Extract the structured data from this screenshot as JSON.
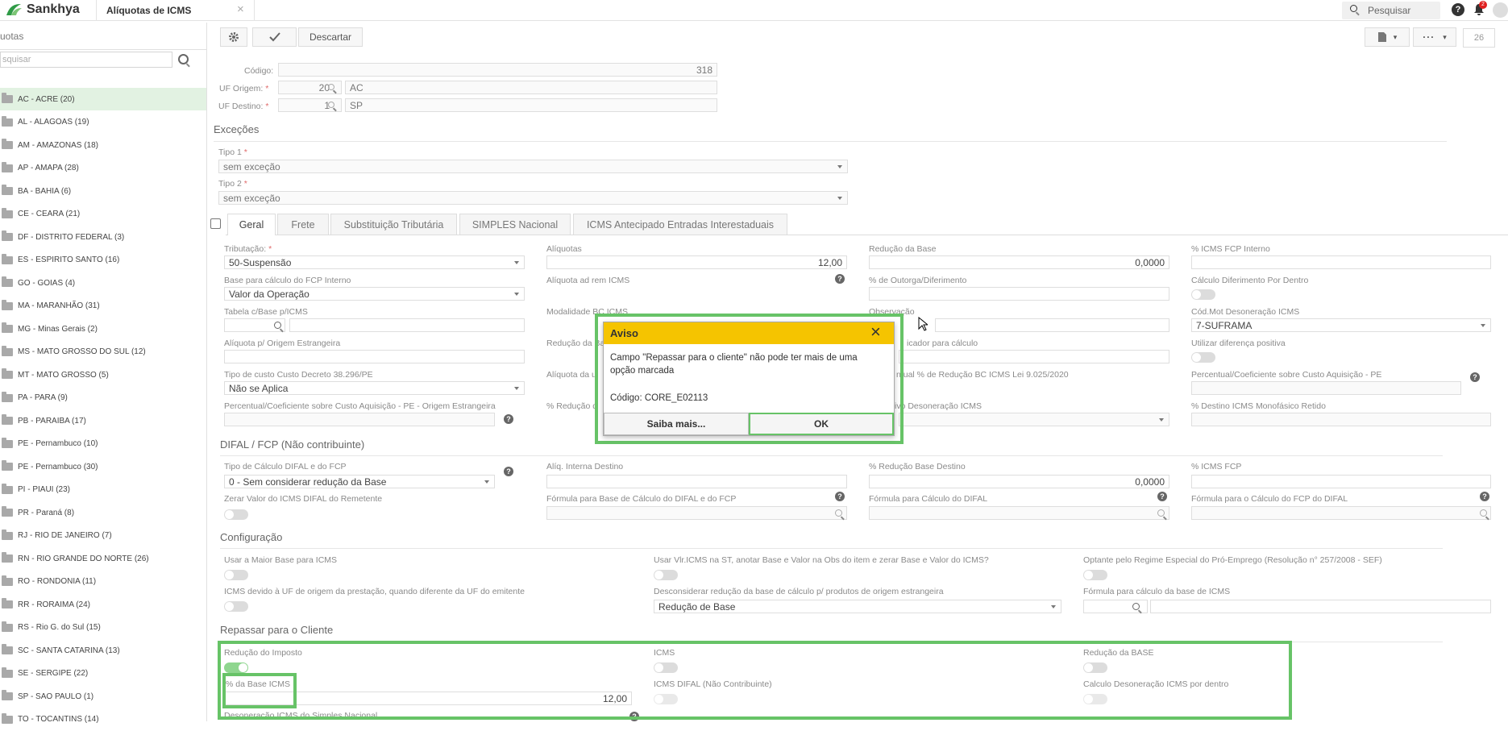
{
  "app": {
    "brand": "Sankhya",
    "tab_title": "Alíquotas de ICMS",
    "search_label": "Pesquisar",
    "notif_count": "2",
    "help_icon": "help-icon",
    "bell_icon": "bell-icon"
  },
  "toolbar": {
    "discard": "Descartar",
    "page_num": "26"
  },
  "sidebar": {
    "title": "uotas",
    "search_placeholder": "squisar",
    "items": [
      "AC - ACRE (20)",
      "AL - ALAGOAS (19)",
      "AM - AMAZONAS (18)",
      "AP - AMAPA (28)",
      "BA - BAHIA (6)",
      "CE - CEARA (21)",
      "DF - DISTRITO FEDERAL (3)",
      "ES - ESPIRITO SANTO (16)",
      "GO - GOIAS (4)",
      "MA - MARANHÃO (31)",
      "MG - Minas Gerais (2)",
      "MS - MATO GROSSO DO SUL (12)",
      "MT - MATO GROSSO (5)",
      "PA - PARA (9)",
      "PB - PARAIBA (17)",
      "PE - Pernambuco (10)",
      "PE - Pernambuco (30)",
      "PI - PIAUI (23)",
      "PR - Paraná (8)",
      "RJ - RIO DE JANEIRO (7)",
      "RN - RIO GRANDE DO NORTE (26)",
      "RO - RONDONIA (11)",
      "RR - RORAIMA (24)",
      "RS - Rio G. do Sul (15)",
      "SC - SANTA CATARINA (13)",
      "SE - SERGIPE (22)",
      "SP - SAO PAULO (1)",
      "TO - TOCANTINS (14)"
    ]
  },
  "header": {
    "codigo_label": "Código:",
    "codigo": "318",
    "uf_origem_label": "UF Origem:",
    "uf_origem_cod": "20",
    "uf_origem": "AC",
    "uf_destino_label": "UF Destino:",
    "uf_destino_cod": "1",
    "uf_destino": "SP"
  },
  "excecoes": {
    "title": "Exceções",
    "tipo1_label": "Tipo 1",
    "tipo1": "sem exceção",
    "tipo2_label": "Tipo 2",
    "tipo2": "sem exceção"
  },
  "tabs": [
    "Geral",
    "Frete",
    "Substituição Tributária",
    "SIMPLES Nacional",
    "ICMS Antecipado Entradas Interestaduais"
  ],
  "geral": {
    "tributacao_label": "Tributação:",
    "tributacao": "50-Suspensão",
    "aliquotas_label": "Alíquotas",
    "aliquotas": "12,00",
    "reducao_base_label": "Redução da Base",
    "reducao_base": "0,0000",
    "fcp_interno_label": "% ICMS FCP Interno",
    "base_fcp_label": "Base para cálculo do FCP Interno",
    "base_fcp": "Valor da Operação",
    "adrem_label": "Alíquota ad rem ICMS",
    "outorga_label": "% de Outorga/Diferimento",
    "calc_dif_label": "Cálculo Diferimento Por Dentro",
    "tabela_label": "Tabela c/Base p/ICMS",
    "modalidade_label": "Modalidade BC ICMS",
    "observacao_label": "Observação",
    "cod_mot_label": "Cód.Mot Desoneração ICMS",
    "cod_mot": "7-SUFRAMA",
    "aliq_orig_label": "Alíquota p/ Origem Estrangeira",
    "reducao_ba_label": "Redução da Ba",
    "indicador_label": "icador para cálculo",
    "util_dif_label": "Utilizar diferença positiva",
    "tipo_custo_label": "Tipo de custo Custo Decreto 38.296/PE",
    "tipo_custo": "Não se Aplica",
    "aliq_ua_label": "Alíquota da u",
    "perc_lei_label": "ntual % de Redução BC ICMS Lei 9.025/2020",
    "perc_coef_label": "Percentual/Coeficiente sobre Custo Aquisição - PE",
    "perc_coef_est_label": "Percentual/Coeficiente sobre Custo Aquisição - PE - Origem Estrangeira",
    "perc_red_label": "% Redução d",
    "desoneracao_label": "ivo Desoneração ICMS",
    "dest_mono_label": "% Destino ICMS Monofásico Retido"
  },
  "difal": {
    "title": "DIFAL / FCP (Não contribuinte)",
    "tipo_calc_label": "Tipo de Cálculo DIFAL e do FCP",
    "tipo_calc": "0 - Sem considerar redução da Base",
    "aliq_int_label": "Alíq. Interna Destino",
    "red_base_dest_label": "% Redução Base Destino",
    "red_base_dest": "0,0000",
    "icms_fcp_label": "% ICMS FCP",
    "zerar_label": "Zerar Valor do ICMS DIFAL do Remetente",
    "formula_base_label": "Fórmula para Base de Cálculo do DIFAL e do FCP",
    "formula_difal_label": "Fórmula para Cálculo do DIFAL",
    "formula_fcp_label": "Fórmula para o Cálculo do FCP do DIFAL"
  },
  "config": {
    "title": "Configuração",
    "maior_base_label": "Usar a Maior Base para ICMS",
    "vlr_icms_st_label": "Usar Vlr.ICMS na ST, anotar Base e Valor na Obs do item e zerar Base e Valor do ICMS?",
    "optante_label": "Optante pelo Regime Especial do Pró-Emprego (Resolução n° 257/2008 - SEF)",
    "icms_devido_label": "ICMS devido à UF de origem da prestação, quando diferente da UF do emitente",
    "desconsiderar_label": "Desconsiderar redução da base de cálculo p/ produtos de origem estrangeira",
    "desconsiderar": "Redução de Base",
    "formula_icms_label": "Fórmula para cálculo da base de ICMS"
  },
  "repassar": {
    "title": "Repassar para o Cliente",
    "reducao_imposto_label": "Redução do Imposto",
    "reducao_imposto_on": true,
    "icms_label": "ICMS",
    "reducao_base_label": "Redução da BASE",
    "perc_base_label": "% da Base ICMS",
    "perc_base": "12,00",
    "icms_difal_label": "ICMS DIFAL (Não Contribuinte)",
    "calc_deson_label": "Calculo Desoneração ICMS por dentro",
    "cut_label": "Desoneração ICMS do Simples Nacional"
  },
  "dialog": {
    "title": "Aviso",
    "message": "Campo \"Repassar para o cliente\" não pode ter mais de uma opção marcada",
    "code": "Código: CORE_E02113",
    "more": "Saiba mais...",
    "ok": "OK"
  },
  "colors": {
    "accent": "#67c367",
    "dialog_header": "#f5c400",
    "brand": "#2f9b47"
  }
}
